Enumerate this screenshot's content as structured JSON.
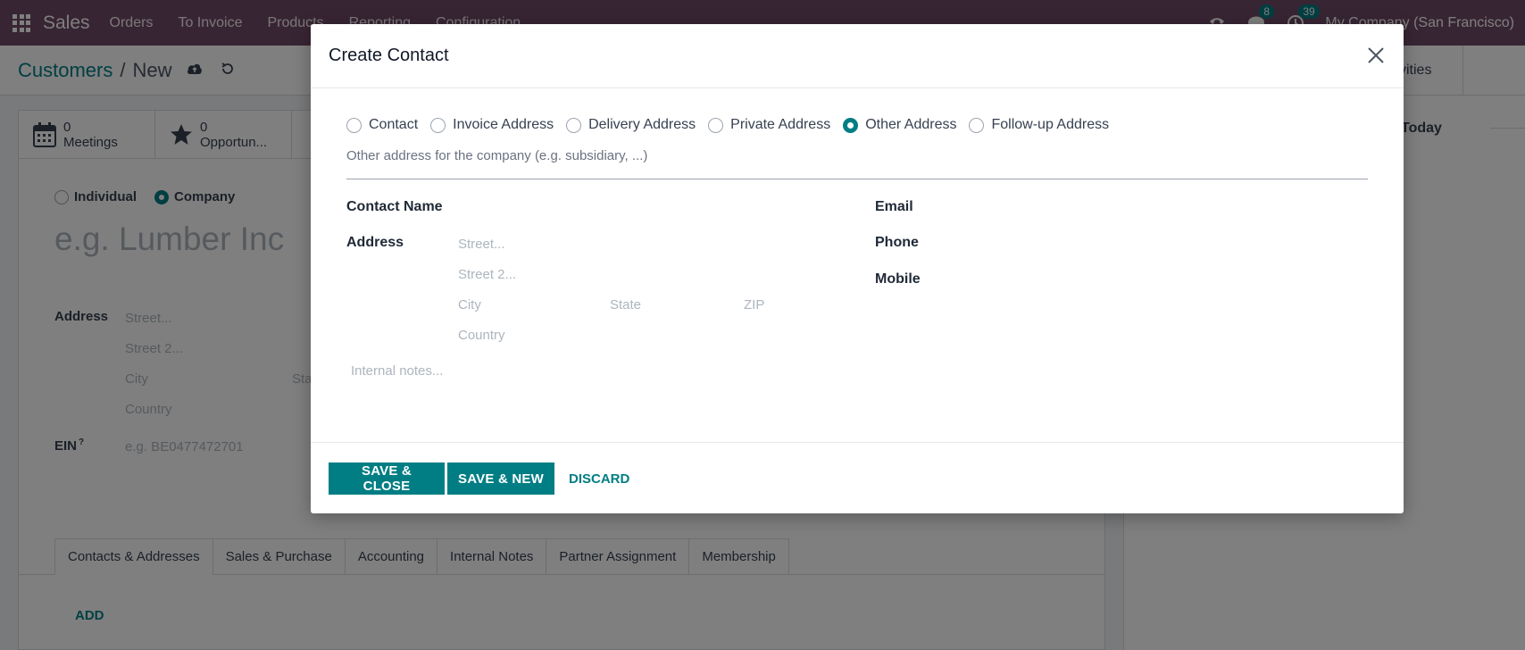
{
  "topnav": {
    "brand": "Sales",
    "menu": [
      "Orders",
      "To Invoice",
      "Products",
      "Reporting",
      "Configuration"
    ],
    "messages_count": "8",
    "activities_count": "39",
    "company": "My Company (San Francisco)"
  },
  "control": {
    "breadcrumb_parent": "Customers",
    "breadcrumb_sep": "/",
    "breadcrumb_current": "New",
    "activities_label": "tivities"
  },
  "form": {
    "smart_buttons": [
      {
        "count": "0",
        "label": "Meetings"
      },
      {
        "count": "0",
        "label": "Opportun..."
      }
    ],
    "company_type": {
      "individual": "Individual",
      "company": "Company"
    },
    "name_placeholder": "e.g. Lumber Inc",
    "address_label": "Address",
    "street_ph": "Street...",
    "street2_ph": "Street 2...",
    "city_ph": "City",
    "state_ph": "Sta",
    "country_ph": "Country",
    "ein_label": "EIN",
    "ein_sup": "?",
    "ein_ph": "e.g. BE0477472701",
    "tabs": [
      "Contacts & Addresses",
      "Sales & Purchase",
      "Accounting",
      "Internal Notes",
      "Partner Assignment",
      "Membership"
    ],
    "add_label": "ADD"
  },
  "chatter": {
    "today": "Today"
  },
  "modal": {
    "title": "Create Contact",
    "types": [
      {
        "label": "Contact",
        "selected": false
      },
      {
        "label": "Invoice Address",
        "selected": false
      },
      {
        "label": "Delivery Address",
        "selected": false
      },
      {
        "label": "Private Address",
        "selected": false
      },
      {
        "label": "Other Address",
        "selected": true
      },
      {
        "label": "Follow-up Address",
        "selected": false
      }
    ],
    "type_description": "Other address for the company (e.g. subsidiary, ...)",
    "contact_name_label": "Contact Name",
    "address_label": "Address",
    "street_ph": "Street...",
    "street2_ph": "Street 2...",
    "city_ph": "City",
    "state_ph": "State",
    "zip_ph": "ZIP",
    "country_ph": "Country",
    "email_label": "Email",
    "phone_label": "Phone",
    "mobile_label": "Mobile",
    "notes_ph": "Internal notes...",
    "save_close": "SAVE & CLOSE",
    "save_new": "SAVE & NEW",
    "discard": "DISCARD"
  },
  "colors": {
    "brand": "#714b67",
    "primary": "#017e84"
  }
}
